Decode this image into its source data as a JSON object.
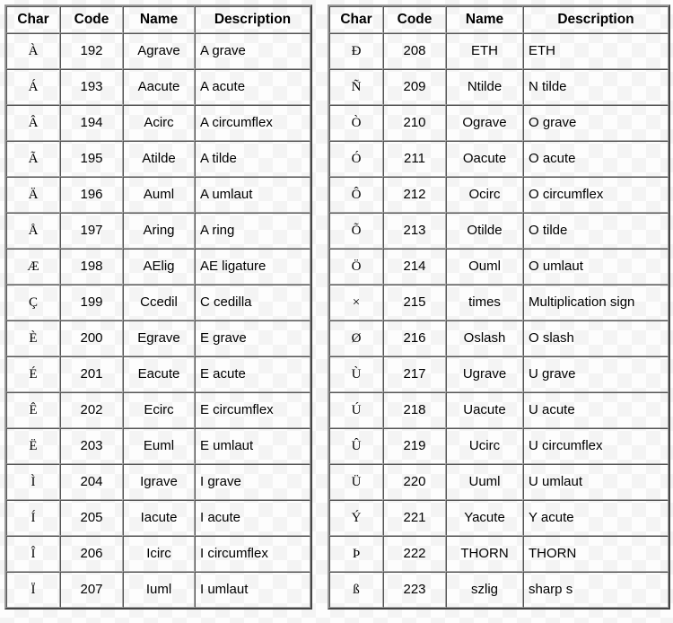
{
  "tables": [
    {
      "id": "left",
      "headers": {
        "char": "Char",
        "code": "Code",
        "name": "Name",
        "description": "Description"
      },
      "rows": [
        {
          "char": "À",
          "code": "192",
          "name": "Agrave",
          "description": "A grave"
        },
        {
          "char": "Á",
          "code": "193",
          "name": "Aacute",
          "description": "A acute"
        },
        {
          "char": "Â",
          "code": "194",
          "name": "Acirc",
          "description": "A circumflex"
        },
        {
          "char": "Ã",
          "code": "195",
          "name": "Atilde",
          "description": "A tilde"
        },
        {
          "char": "Ä",
          "code": "196",
          "name": "Auml",
          "description": "A umlaut"
        },
        {
          "char": "Å",
          "code": "197",
          "name": "Aring",
          "description": "A ring"
        },
        {
          "char": "Æ",
          "code": "198",
          "name": "AElig",
          "description": "AE ligature"
        },
        {
          "char": "Ç",
          "code": "199",
          "name": "Ccedil",
          "description": "C cedilla"
        },
        {
          "char": "È",
          "code": "200",
          "name": "Egrave",
          "description": "E grave"
        },
        {
          "char": "É",
          "code": "201",
          "name": "Eacute",
          "description": "E acute"
        },
        {
          "char": "Ê",
          "code": "202",
          "name": "Ecirc",
          "description": "E circumflex"
        },
        {
          "char": "Ë",
          "code": "203",
          "name": "Euml",
          "description": "E umlaut"
        },
        {
          "char": "Ì",
          "code": "204",
          "name": "Igrave",
          "description": "I grave"
        },
        {
          "char": "Í",
          "code": "205",
          "name": "Iacute",
          "description": "I acute"
        },
        {
          "char": "Î",
          "code": "206",
          "name": "Icirc",
          "description": "I circumflex"
        },
        {
          "char": "Ï",
          "code": "207",
          "name": "Iuml",
          "description": "I umlaut"
        }
      ]
    },
    {
      "id": "right",
      "headers": {
        "char": "Char",
        "code": "Code",
        "name": "Name",
        "description": "Description"
      },
      "rows": [
        {
          "char": "Ð",
          "code": "208",
          "name": "ETH",
          "description": "ETH"
        },
        {
          "char": "Ñ",
          "code": "209",
          "name": "Ntilde",
          "description": "N tilde"
        },
        {
          "char": "Ò",
          "code": "210",
          "name": "Ograve",
          "description": "O grave"
        },
        {
          "char": "Ó",
          "code": "211",
          "name": "Oacute",
          "description": "O acute"
        },
        {
          "char": "Ô",
          "code": "212",
          "name": "Ocirc",
          "description": "O circumflex"
        },
        {
          "char": "Õ",
          "code": "213",
          "name": "Otilde",
          "description": "O tilde"
        },
        {
          "char": "Ö",
          "code": "214",
          "name": "Ouml",
          "description": "O umlaut"
        },
        {
          "char": "×",
          "code": "215",
          "name": "times",
          "description": "Multiplication sign"
        },
        {
          "char": "Ø",
          "code": "216",
          "name": "Oslash",
          "description": "O slash"
        },
        {
          "char": "Ù",
          "code": "217",
          "name": "Ugrave",
          "description": "U grave"
        },
        {
          "char": "Ú",
          "code": "218",
          "name": "Uacute",
          "description": "U acute"
        },
        {
          "char": "Û",
          "code": "219",
          "name": "Ucirc",
          "description": "U circumflex"
        },
        {
          "char": "Ü",
          "code": "220",
          "name": "Uuml",
          "description": "U umlaut"
        },
        {
          "char": "Ý",
          "code": "221",
          "name": "Yacute",
          "description": "Y acute"
        },
        {
          "char": "Þ",
          "code": "222",
          "name": "THORN",
          "description": "THORN"
        },
        {
          "char": "ß",
          "code": "223",
          "name": "szlig",
          "description": "sharp s"
        }
      ]
    }
  ]
}
